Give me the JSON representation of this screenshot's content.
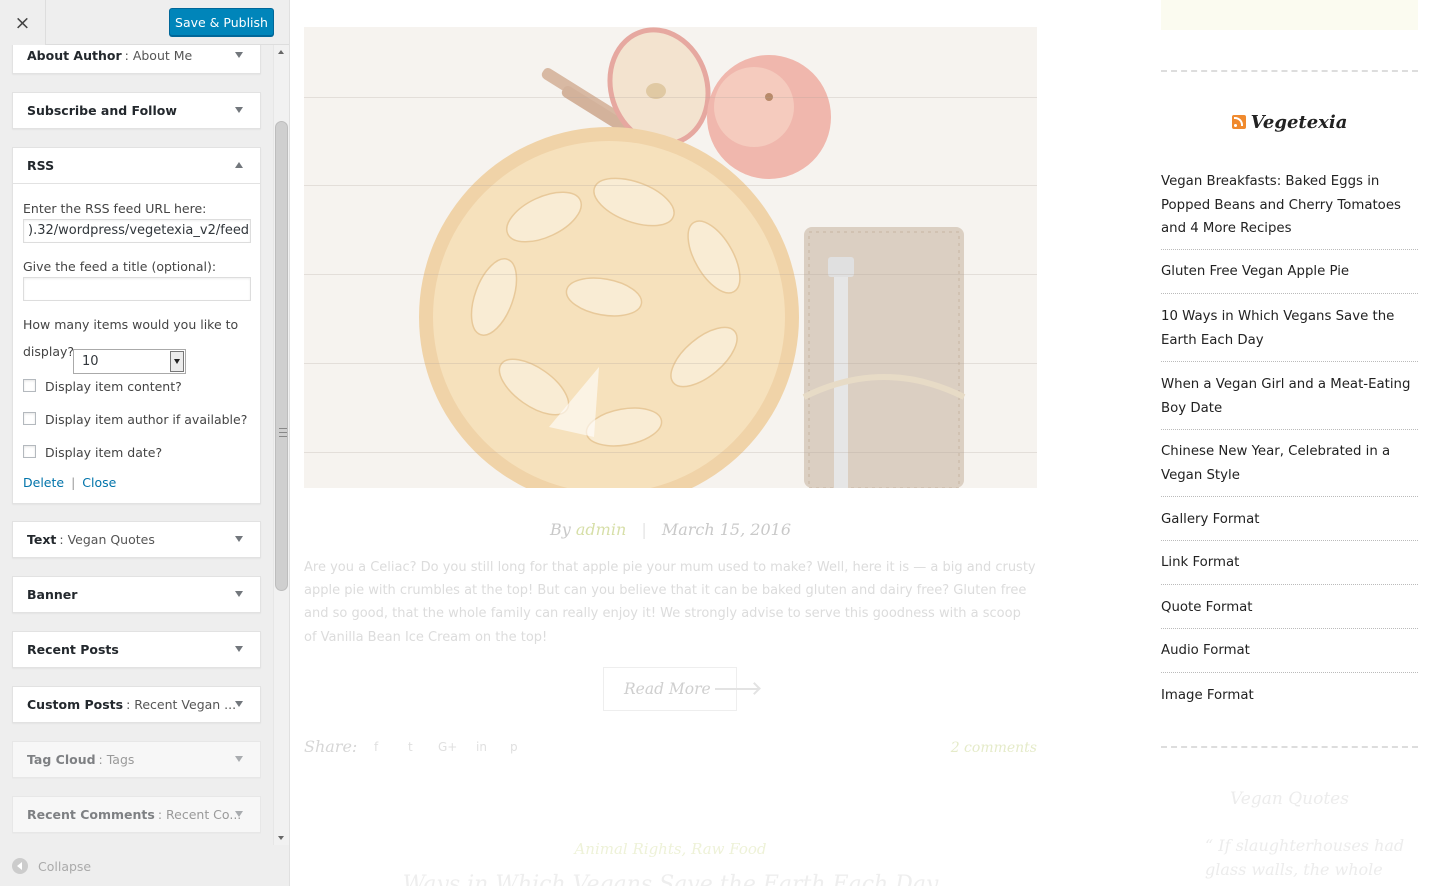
{
  "customizer": {
    "close_icon": "×",
    "publish_label": "Save & Publish",
    "collapse_label": "Collapse"
  },
  "widgets": [
    {
      "title": "About Author",
      "subtitle": ": About Me"
    },
    {
      "title": "Subscribe and Follow",
      "subtitle": ""
    },
    {
      "title": "RSS",
      "subtitle": ""
    },
    {
      "title": "Text",
      "subtitle": ": Vegan Quotes"
    },
    {
      "title": "Banner",
      "subtitle": ""
    },
    {
      "title": "Recent Posts",
      "subtitle": ""
    },
    {
      "title": "Custom Posts",
      "subtitle": ": Recent Vegan ..."
    },
    {
      "title": "Tag Cloud",
      "subtitle": ": Tags"
    },
    {
      "title": "Recent Comments",
      "subtitle": ": Recent Co..."
    }
  ],
  "rss_form": {
    "url_label": "Enter the RSS feed URL here:",
    "url_value": ").32/wordpress/vegetexia_v2/feed",
    "title_label": "Give the feed a title (optional):",
    "title_value": "",
    "items_label_1": "How many items would you like to",
    "items_label_2": "display?",
    "items_value": "10",
    "cb_content": "Display item content?",
    "cb_author": "Display item author if available?",
    "cb_date": "Display item date?",
    "delete_label": "Delete",
    "divider": "|",
    "close_label": "Close"
  },
  "post": {
    "by": "By",
    "author": "admin",
    "meta_sep": "|",
    "date": "March 15, 2016",
    "excerpt": "Are you a Celiac? Do you still long for that apple pie your mum used to make? Well, here it is — a big and crusty apple pie with crumbles at the top! But can you believe that it can be baked gluten and dairy free? Gluten free and so good, that the whole family can really enjoy it! We strongly advise to serve this goodness with a scoop of Vanilla Bean Ice Cream on the top!",
    "read_more": "Read More",
    "share_label": "Share:",
    "share_icons": [
      "f",
      "t",
      "G+",
      "in",
      "p"
    ],
    "comments": "2 comments",
    "next_categories": "Animal Rights, Raw Food",
    "next_title": "Ways in Which Vegans Save the Earth Each Day"
  },
  "rss_widget": {
    "title": "Vegetexia",
    "items": [
      "Vegan Breakfasts: Baked Eggs in Popped Beans and Cherry Tomatoes and 4 More Recipes",
      "Gluten Free Vegan Apple Pie",
      "10 Ways in Which Vegans Save the Earth Each Day",
      "When a Vegan Girl and a Meat-Eating Boy Date",
      "Chinese New Year, Celebrated in a Vegan Style",
      "Gallery Format",
      "Link Format",
      "Quote Format",
      "Audio Format",
      "Image Format"
    ]
  },
  "quotes_widget": {
    "title": "Vegan Quotes",
    "quote": "“ If slaughterhouses had glass walls, the whole world"
  }
}
